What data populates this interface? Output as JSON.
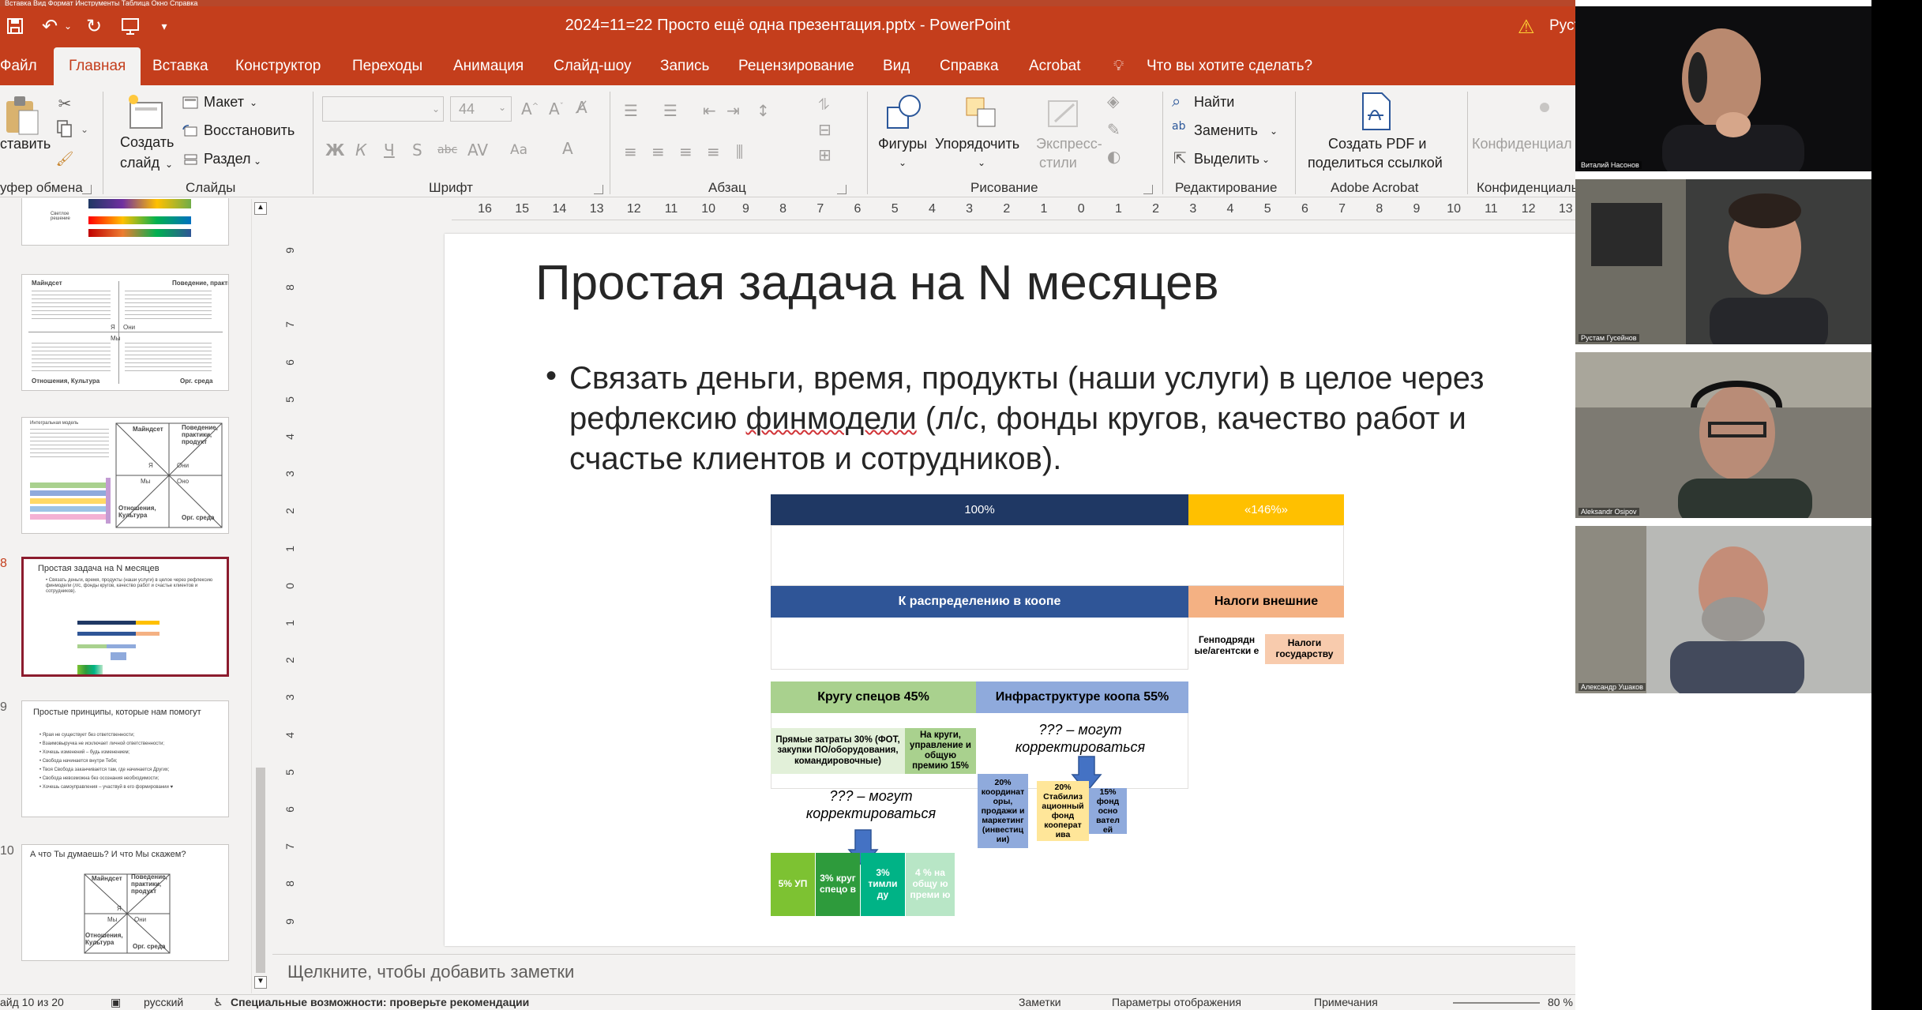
{
  "menu_strip": "Вставка  Вид  Формат  Инструменты  Таблица  Окно  Справка",
  "title_bar": {
    "document": "2024=11=22 Просто ещё одна презентация.pptx  -  PowerPoint",
    "user": "Руст"
  },
  "tabs": [
    "Файл",
    "Главная",
    "Вставка",
    "Конструктор",
    "Переходы",
    "Анимация",
    "Слайд-шоу",
    "Запись",
    "Рецензирование",
    "Вид",
    "Справка",
    "Acrobat"
  ],
  "tell_me": "Что вы хотите сделать?",
  "ribbon": {
    "clipboard": {
      "paste": "ставить",
      "label": "уфер обмена"
    },
    "slides": {
      "new_slide_1": "Создать",
      "new_slide_2": "слайд",
      "layout": "Макет",
      "reset": "Восстановить",
      "section": "Раздел",
      "label": "Слайды"
    },
    "font": {
      "size": "44",
      "label": "Шрифт"
    },
    "paragraph": {
      "label": "Абзац"
    },
    "drawing": {
      "shapes": "Фигуры",
      "arrange": "Упорядочить",
      "quick_styles_1": "Экспресс-",
      "quick_styles_2": "стили",
      "label": "Рисование"
    },
    "editing": {
      "find": "Найти",
      "replace": "Заменить",
      "select": "Выделить",
      "label": "Редактирование"
    },
    "acrobat": {
      "create_1": "Создать PDF и",
      "create_2": "поделиться ссылкой",
      "label": "Adobe Acrobat"
    },
    "sensitivity": {
      "button": "Конфиденциал",
      "label": "Конфиденциаль"
    }
  },
  "ruler": {
    "h_ticks": [
      "16",
      "15",
      "14",
      "13",
      "12",
      "11",
      "10",
      "9",
      "8",
      "7",
      "6",
      "5",
      "4",
      "3",
      "2",
      "1",
      "0",
      "1",
      "2",
      "3",
      "4",
      "5",
      "6",
      "7",
      "8",
      "9",
      "10",
      "11",
      "12",
      "13"
    ],
    "v_ticks": [
      "9",
      "8",
      "7",
      "6",
      "5",
      "4",
      "3",
      "2",
      "1",
      "0",
      "1",
      "2",
      "3",
      "4",
      "5",
      "6",
      "7",
      "8",
      "9"
    ]
  },
  "thumbnails": {
    "t1_small": "Светлое\nрешение",
    "t2": {
      "num": "",
      "tl": "Майндсет",
      "tr": "Поведение, практики",
      "mid_l": "Я",
      "mid_r": "Мы",
      "mid_r2": "Они",
      "bl": "Отношения, Культура",
      "br": "Орг. среда"
    },
    "t3": {
      "num": "",
      "tl": "Майндсет",
      "tr": "Поведение, практики, продукт",
      "i": "Я",
      "we": "Мы",
      "they": "Они",
      "they2": "Оно",
      "bl": "Отношения, Культура",
      "br": "Орг. среда",
      "left_title": "Интегральная модель"
    },
    "t4": {
      "num": "8",
      "title": "Простая задача на N месяцев",
      "text": "• Связать деньги, время, продукты (наши услуги) в целое через рефлексию финмодели (л/с, фонды кругов, качество работ и счастье клиентов и сотрудников)."
    },
    "t5": {
      "num": "9",
      "title": "Простые принципы, которые нам помогут",
      "items": [
        "• Ярая не существует без ответственности;",
        "• Взаимовыручка не исключает личной ответственности;",
        "• Хочешь изменений – будь изменением;",
        "• Свобода начинается внутри Тебя;",
        "• Твоя Свобода заканчивается там, где начинается Других;",
        "• Свобода невозможна без осознания необходимости;",
        "• Хочешь самоуправления – участвуй в его формировании ♥"
      ]
    },
    "t6": {
      "num": "10",
      "title": "А что Ты думаешь? И что Мы скажем?",
      "tl": "Майндсет",
      "tr": "Поведение, практики, продукт",
      "i": "Я",
      "we": "Мы",
      "they": "Они",
      "bl": "Отношения, Культура",
      "br": "Орг. среда"
    }
  },
  "slide": {
    "title": "Простая задача на N месяцев",
    "bullet_pre": "Связать деньги, время, продукты (наши услуги) в целое через рефлексию ",
    "bullet_err": "финмодели",
    "bullet_post": " (л/с, фонды кругов, качество работ и счастье клиентов и сотрудников).",
    "diagram": {
      "top_left": "100%",
      "top_right": "«146%»",
      "dist": "К распределению в коопе",
      "taxes": "Налоги внешние",
      "gen": "Генподрядн ые/агентски е",
      "gov": "Налоги государству",
      "circles": "Кругу спецов 45%",
      "infra": "Инфраструктуре коопа 55%",
      "direct": "Прямые затраты 30% (ФОТ, закупки ПО/оборудования, командировочные)",
      "to_circles": "На круги, управление и общую премию 15%",
      "adjust1_a": "??? – могут",
      "adjust1_b": "корректироваться",
      "adjust2_a": "??? – могут",
      "adjust2_b": "корректироваться",
      "coord": "20% координат оры, продажи и маркетинг (инвестиц ии)",
      "stab": "20% Стабилиз ационный фонд кооперат ива",
      "founders": "15% фонд осно вател ей",
      "up": "5% УП",
      "crug": "3% круг спецо в",
      "team": "3% тимли ду",
      "general": "4 % на общу ю преми ю"
    }
  },
  "notes": "Щелкните, чтобы добавить заметки",
  "status": {
    "slide": "айд 10 из 20",
    "lang": "русский",
    "accessibility": "Специальные возможности: проверьте рекомендации",
    "notes": "Заметки",
    "display": "Параметры отображения",
    "comments": "Примечания",
    "zoom": "80 %"
  },
  "video": {
    "p1": "Виталий Насонов",
    "p2": "Рустам Гусейнов",
    "p3": "Aleksandr Osipov",
    "p4": "Александр Ушаков"
  },
  "colors": {
    "brand": "#c43e1c",
    "navy": "#1f3864",
    "blue": "#2f5597",
    "gold": "#ffc000",
    "orange": "#f4b183",
    "peach": "#f8cbad",
    "green_light": "#a9d18e",
    "green_pale": "#e2f0d9",
    "periwinkle": "#8faadc",
    "yellow_pale": "#ffe699",
    "lime": "#7dc232",
    "green_dark": "#2e9b3c",
    "teal": "#00b386",
    "mint": "#b8e6c6"
  }
}
